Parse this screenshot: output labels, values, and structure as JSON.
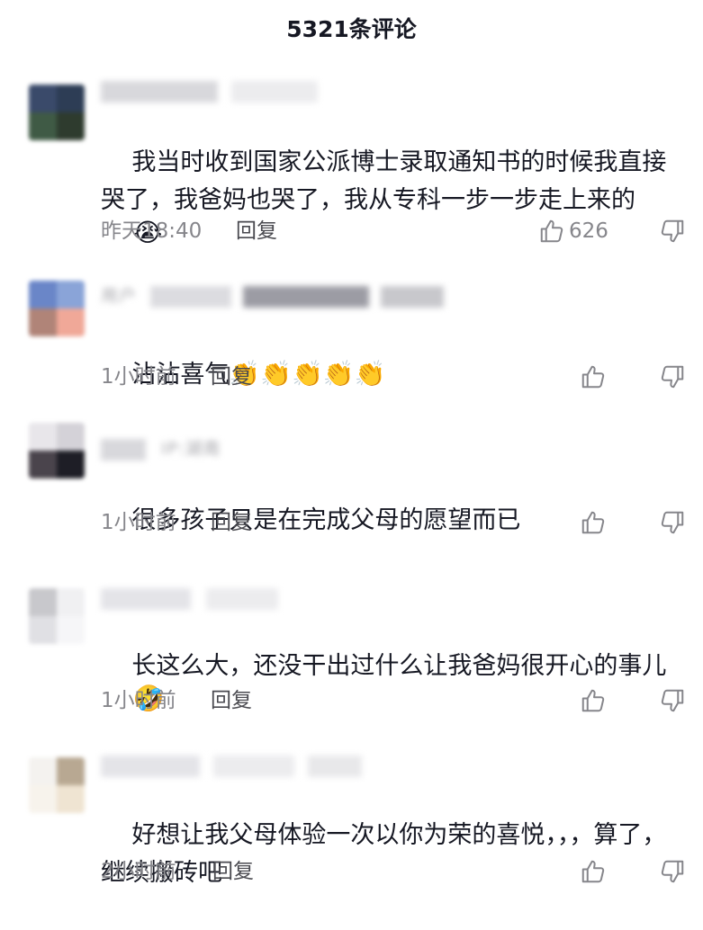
{
  "header": {
    "title": "5321条评论"
  },
  "reply_label": "回复",
  "comments": [
    {
      "text": "我当时收到国家公派博士录取通知书的时候我直接哭了，我爸妈也哭了，我从专科一步一步走上来的",
      "emoji": "😭",
      "time": "昨天18:40",
      "likes": "626",
      "avatar_icon": "user-avatar-icon"
    },
    {
      "text": "沾沾喜气",
      "emoji": "👏👏👏👏👏",
      "time": "1小时前",
      "likes": "",
      "avatar_icon": "user-avatar-icon"
    },
    {
      "text": "很多孩子只是在完成父母的愿望而已",
      "emoji": "",
      "time": "1小时前",
      "likes": "",
      "avatar_icon": "user-avatar-icon"
    },
    {
      "text": "长这么大，还没干出过什么让我爸妈很开心的事儿",
      "emoji": "🤣",
      "time": "1小时前",
      "likes": "",
      "avatar_icon": "user-avatar-icon"
    },
    {
      "text": "好想让我父母体验一次以你为荣的喜悦，，，算了，继续搬砖吧",
      "emoji": "",
      "time": "2小时前",
      "likes": "",
      "avatar_icon": "user-avatar-icon"
    }
  ],
  "meta_partial": {
    "c2": "用户",
    "c3": "IP:湖南"
  },
  "icons": {
    "like": "thumbs-up-icon",
    "dislike": "thumbs-down-icon"
  }
}
